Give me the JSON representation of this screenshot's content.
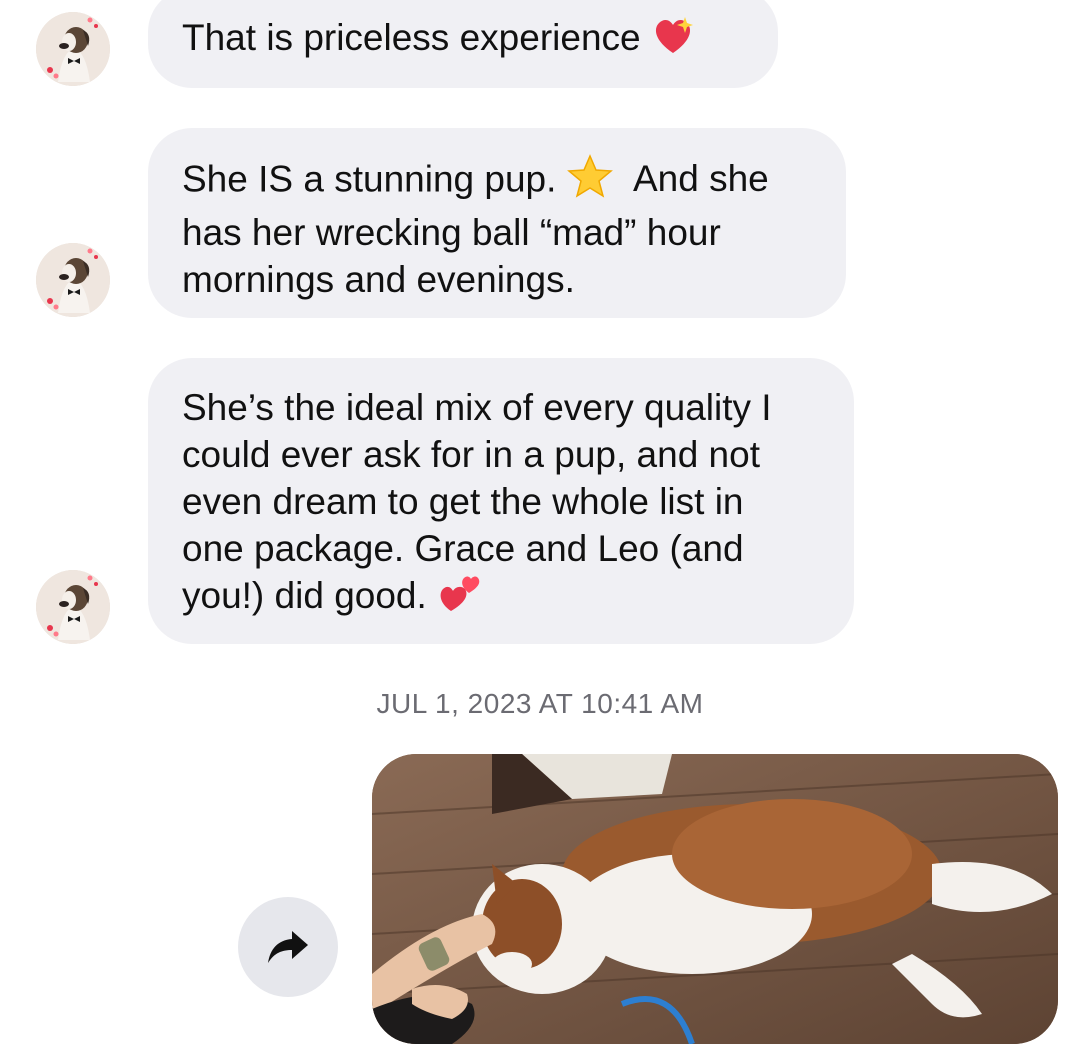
{
  "messages": [
    {
      "text_before": "That is priceless experience",
      "emoji": "sparkling-heart-emoji",
      "text_after": ""
    },
    {
      "line1_before": "She IS a stunning pup.",
      "emoji": "star-emoji",
      "line1_after": "And she",
      "line2": "has her wrecking ball “mad” hour",
      "line3": "mornings and evenings."
    },
    {
      "line1": "She’s the ideal mix of every quality I",
      "line2": "could ever ask for in a pup, and not",
      "line3": "even dream to get the whole list in",
      "line4": "one package. Grace and Leo (and",
      "line5": "you!) did good.",
      "emoji": "two-hearts-emoji"
    }
  ],
  "timestamp": "JUL 1, 2023 AT 10:41 AM",
  "photo": {
    "description_icon": "puppy-photo"
  },
  "share_button": {
    "icon": "share-arrow-icon"
  },
  "colors": {
    "bubble": "#f0f0f4",
    "timestamp": "#6b6b72",
    "share_bg": "#e6e7ec"
  }
}
